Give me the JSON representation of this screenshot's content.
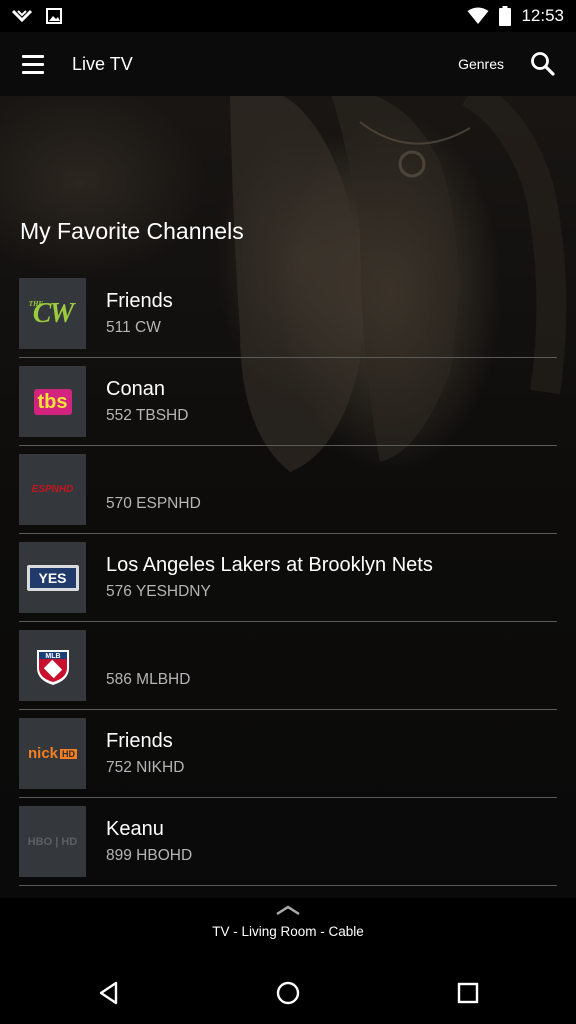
{
  "status_bar": {
    "time": "12:53",
    "icons": [
      "notification-icon",
      "image-icon",
      "wifi-icon",
      "battery-icon"
    ]
  },
  "app_bar": {
    "menu_icon": "hamburger-menu-icon",
    "title": "Live TV",
    "genres_label": "Genres",
    "search_icon": "search-icon"
  },
  "section": {
    "title": "My Favorite Channels"
  },
  "channels": [
    {
      "logo": "CW",
      "title": "Friends",
      "subtitle": "511 CW"
    },
    {
      "logo": "tbs",
      "title": "Conan",
      "subtitle": "552 TBSHD"
    },
    {
      "logo": "ESPNHD",
      "title": "",
      "subtitle": "570 ESPNHD"
    },
    {
      "logo": "YES",
      "title": "Los Angeles Lakers at Brooklyn Nets",
      "subtitle": "576 YESHDNY"
    },
    {
      "logo": "MLB NETWORK",
      "title": "",
      "subtitle": "586 MLBHD"
    },
    {
      "logo": "nick HD",
      "title": "Friends",
      "subtitle": "752 NIKHD"
    },
    {
      "logo": "HBO HD",
      "title": "Keanu",
      "subtitle": "899 HBOHD"
    }
  ],
  "now_playing": {
    "device": "TV - Living Room - Cable"
  },
  "colors": {
    "background": "#000000",
    "logo_tile": "#34373b",
    "divider": "#5a5a5a",
    "subtitle_text": "#b5b5b5"
  }
}
